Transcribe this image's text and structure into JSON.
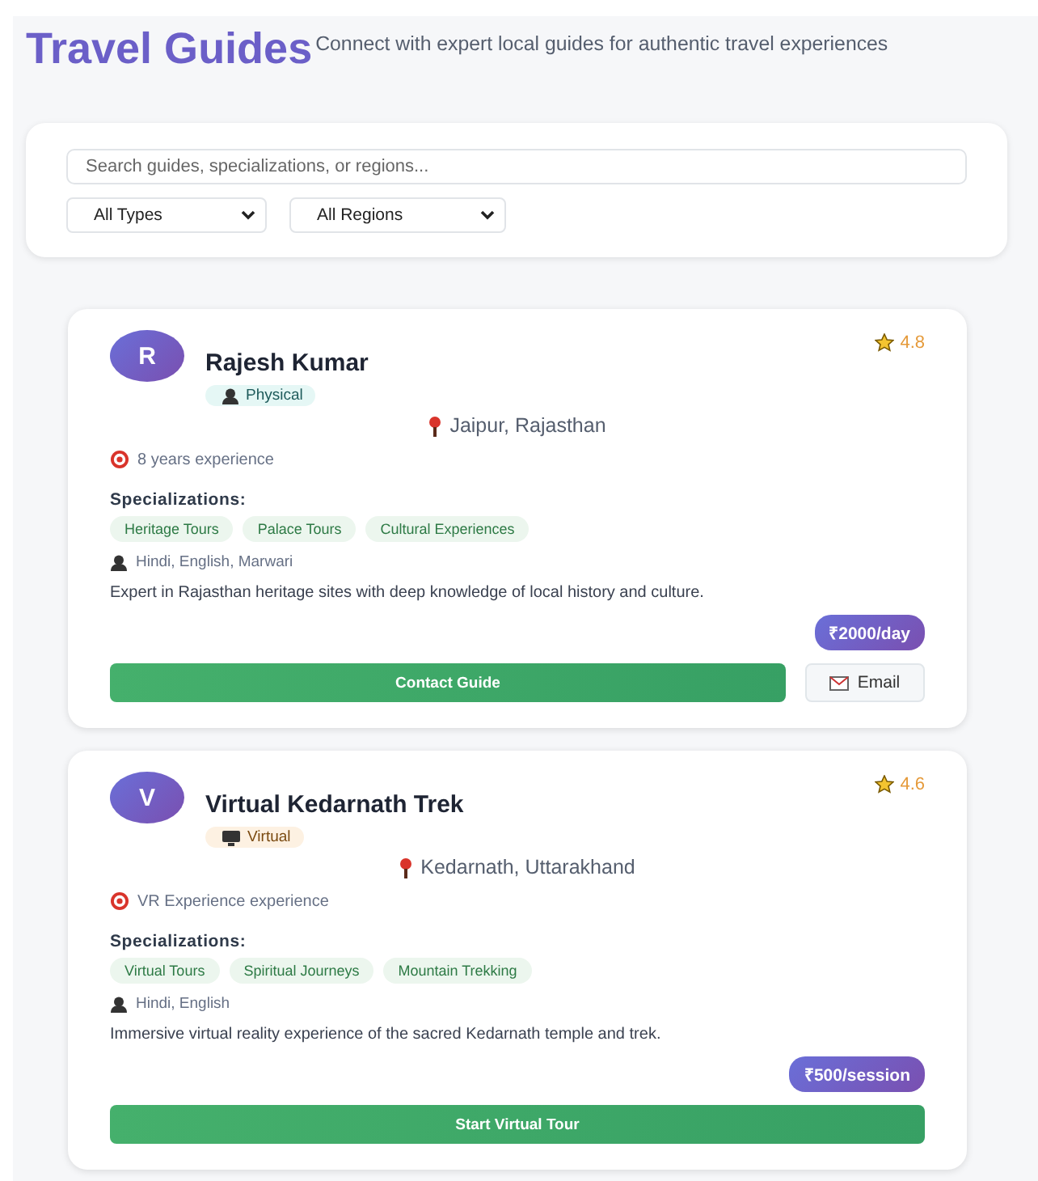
{
  "header": {
    "title": "Travel Guides",
    "subtitle": "Connect with expert local guides for authentic travel experiences"
  },
  "filters": {
    "search": {
      "placeholder": "Search guides, specializations, or regions..."
    },
    "selects": [
      {
        "value": "All Types"
      },
      {
        "value": "All Regions"
      }
    ]
  },
  "guides": [
    {
      "initial": "R",
      "name": "Rajesh Kumar",
      "kind": "physical",
      "type_label": "Physical",
      "rating": "4.8",
      "location": "Jaipur, Rajasthan",
      "experience": "8 years experience",
      "specializations_heading": "Specializations:",
      "specializations": [
        "Heritage Tours",
        "Palace Tours",
        "Cultural Experiences"
      ],
      "languages": "Hindi, English, Marwari",
      "description": "Expert in Rajasthan heritage sites with deep knowledge of local history and culture.",
      "price": "₹2000/day",
      "actions": [
        {
          "kind": "primary",
          "label": "Contact Guide"
        },
        {
          "kind": "email",
          "label": "Email"
        }
      ]
    },
    {
      "initial": "V",
      "name": "Virtual Kedarnath Trek",
      "kind": "virtual",
      "type_label": "Virtual",
      "rating": "4.6",
      "location": "Kedarnath, Uttarakhand",
      "experience": "VR Experience experience",
      "specializations_heading": "Specializations:",
      "specializations": [
        "Virtual Tours",
        "Spiritual Journeys",
        "Mountain Trekking"
      ],
      "languages": "Hindi, English",
      "description": "Immersive virtual reality experience of the sacred Kedarnath temple and trek.",
      "price": "₹500/session",
      "actions": [
        {
          "kind": "primary",
          "label": "Start Virtual Tour"
        }
      ]
    }
  ]
}
